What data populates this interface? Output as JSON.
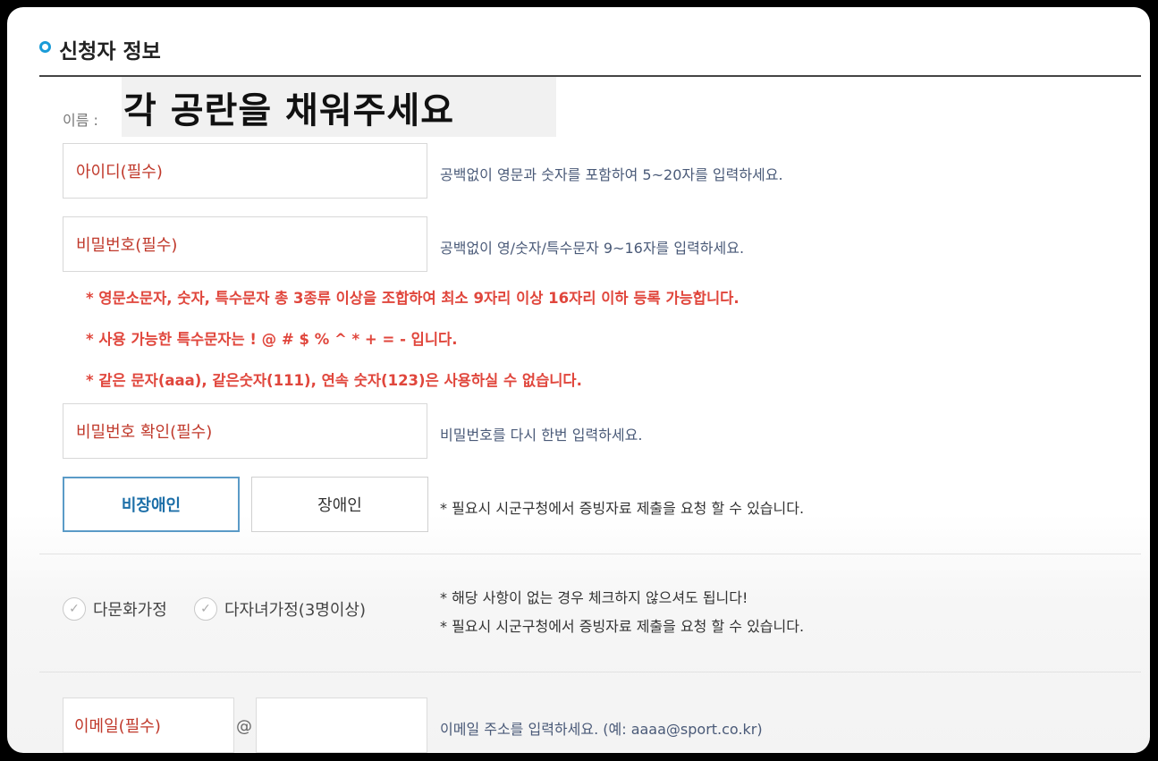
{
  "section": {
    "title": "신청자 정보",
    "name_label": "이름 :",
    "overlay_text": "각 공란을 채워주세요"
  },
  "fields": {
    "id": {
      "placeholder": "아이디(필수)",
      "hint": "공백없이 영문과 숫자를 포함하여 5~20자를 입력하세요."
    },
    "password": {
      "placeholder": "비밀번호(필수)",
      "hint": "공백없이 영/숫자/특수문자 9~16자를 입력하세요."
    },
    "password_confirm": {
      "placeholder": "비밀번호 확인(필수)",
      "hint": "비밀번호를 다시 한번 입력하세요."
    }
  },
  "password_rules": [
    "* 영문소문자, 숫자, 특수문자 총 3종류 이상을 조합하여 최소 9자리 이상 16자리 이하 등록 가능합니다.",
    "* 사용 가능한 특수문자는 ! @ # $ % ^ * + = - 입니다.",
    "* 같은 문자(aaa), 같은숫자(111), 연속 숫자(123)은 사용하실 수 없습니다."
  ],
  "disability": {
    "options": [
      "비장애인",
      "장애인"
    ],
    "selected": "비장애인",
    "note": "* 필요시 시군구청에서 증빙자료 제출을 요청 할 수 있습니다."
  },
  "family": {
    "checks": [
      "다문화가정",
      "다자녀가정(3명이상)"
    ],
    "notes": [
      "* 해당 사항이 없는 경우 체크하지 않으셔도 됩니다!",
      "* 필요시 시군구청에서 증빙자료 제출을 요청 할 수 있습니다."
    ]
  },
  "email": {
    "placeholder": "이메일(필수)",
    "at": "@",
    "hint": "이메일 주소를 입력하세요. (예: aaaa@sport.co.kr)"
  },
  "colors": {
    "accent": "#1a9bd7",
    "required_text": "#c0392b",
    "rule_text": "#e0463c",
    "selected_border": "#5b9bc7"
  },
  "icons": {
    "section_bullet": "circle-bullet-icon",
    "check": "check-circle-icon"
  }
}
